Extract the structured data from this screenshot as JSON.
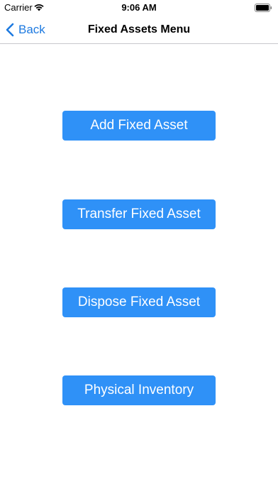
{
  "status_bar": {
    "carrier": "Carrier",
    "time": "9:06 AM",
    "wifi_icon": "wifi-icon",
    "battery_icon": "battery-icon"
  },
  "nav": {
    "back_label": "Back",
    "back_icon": "chevron-left-icon",
    "title": "Fixed Assets Menu"
  },
  "menu": {
    "add_label": "Add Fixed Asset",
    "transfer_label": "Transfer Fixed Asset",
    "dispose_label": "Dispose Fixed Asset",
    "inventory_label": "Physical Inventory"
  },
  "colors": {
    "accent": "#1e7ae0",
    "button_bg": "#2f91f7",
    "button_text": "#ffffff"
  }
}
